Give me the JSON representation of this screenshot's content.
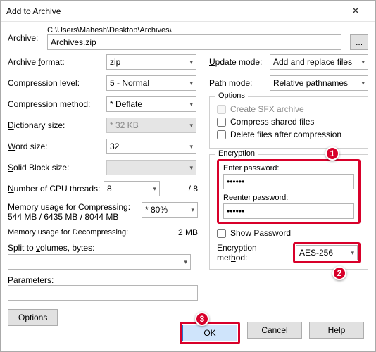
{
  "window": {
    "title": "Add to Archive",
    "close": "✕"
  },
  "archive": {
    "label": "Archive:",
    "path": "C:\\Users\\Mahesh\\Desktop\\Archives\\",
    "filename": "Archives.zip",
    "browse": "..."
  },
  "left": {
    "archive_format": {
      "label": "Archive format:",
      "value": "zip"
    },
    "compression_level": {
      "label": "Compression level:",
      "value": "5 - Normal"
    },
    "compression_method": {
      "label": "Compression method:",
      "value": "* Deflate"
    },
    "dictionary_size": {
      "label": "Dictionary size:",
      "value": "* 32 KB"
    },
    "word_size": {
      "label": "Word size:",
      "value": "32"
    },
    "solid_block": {
      "label": "Solid Block size:",
      "value": ""
    },
    "cpu_threads": {
      "label": "Number of CPU threads:",
      "value": "8",
      "suffix": "/ 8"
    },
    "mem_compress": {
      "label": "Memory usage for Compressing:",
      "detail": "544 MB / 6435 MB / 8044 MB",
      "value": "* 80%"
    },
    "mem_decompress": {
      "label": "Memory usage for Decompressing:",
      "value": "2 MB"
    },
    "split_volumes": {
      "label": "Split to volumes, bytes:",
      "value": ""
    },
    "parameters": {
      "label": "Parameters:",
      "value": ""
    },
    "options_btn": "Options"
  },
  "right": {
    "update_mode": {
      "label": "Update mode:",
      "value": "Add and replace files"
    },
    "path_mode": {
      "label": "Path mode:",
      "value": "Relative pathnames"
    },
    "options_group": {
      "title": "Options",
      "sfx": "Create SFX archive",
      "shared": "Compress shared files",
      "delete_after": "Delete files after compression"
    },
    "encryption": {
      "title": "Encryption",
      "enter_pwd": "Enter password:",
      "pwd_value": "******",
      "reenter_pwd": "Reenter password:",
      "pwd2_value": "******",
      "show_pwd": "Show Password",
      "method_label": "Encryption method:",
      "method_value": "AES-256"
    }
  },
  "footer": {
    "ok": "OK",
    "cancel": "Cancel",
    "help": "Help"
  },
  "badges": {
    "b1": "1",
    "b2": "2",
    "b3": "3"
  }
}
